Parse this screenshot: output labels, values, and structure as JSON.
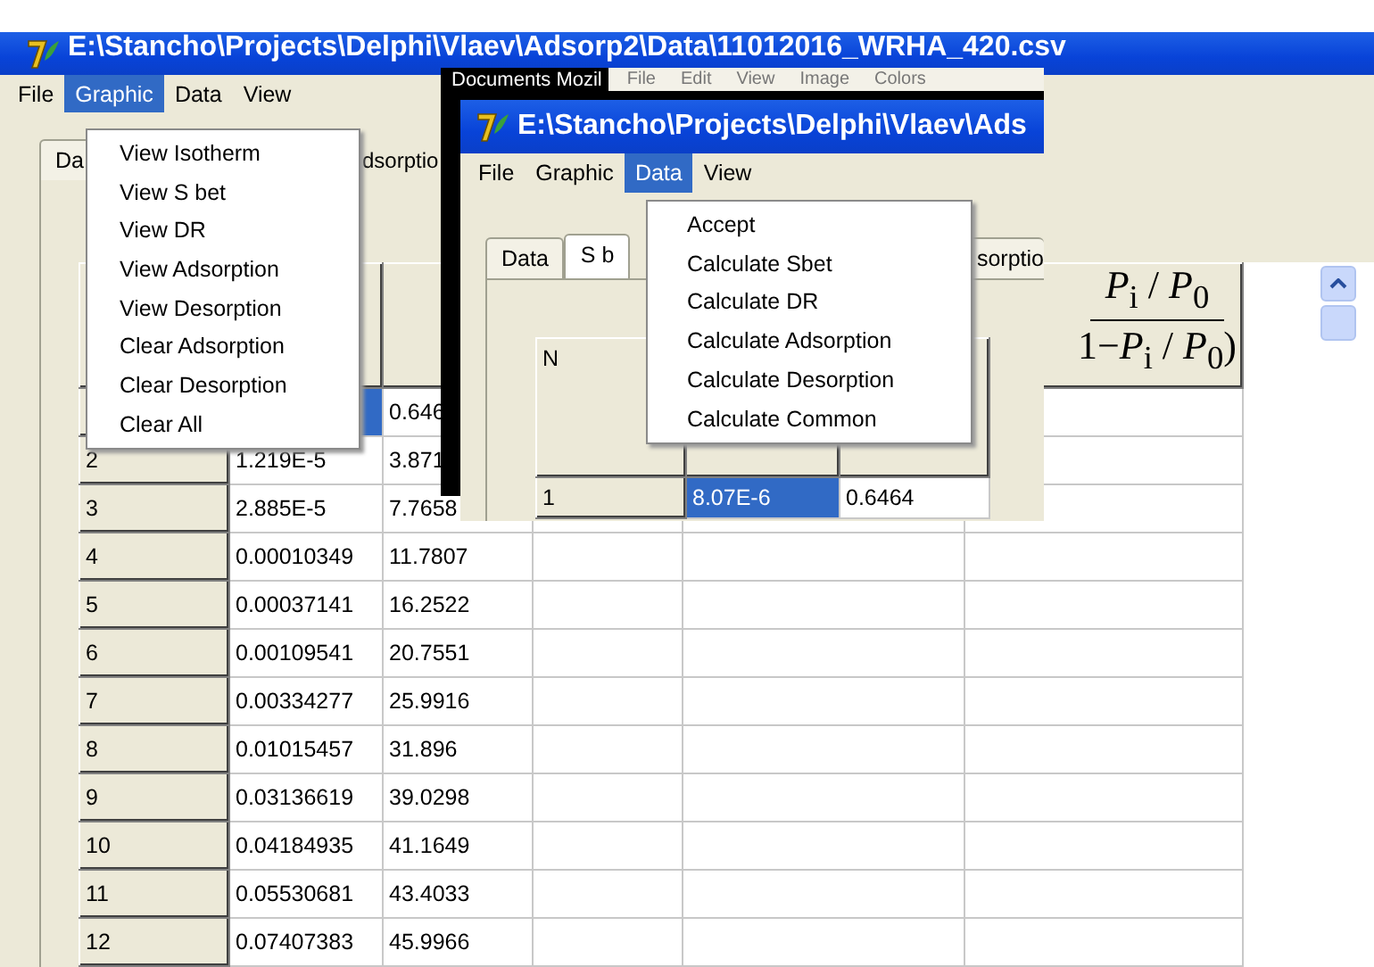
{
  "back_window": {
    "title": "E:\\Stancho\\Projects\\Delphi\\Vlaev\\Adsorp2\\Data\\11012016_WRHA_420.csv",
    "menu": [
      {
        "label": "File",
        "selected": false
      },
      {
        "label": "Graphic",
        "selected": true
      },
      {
        "label": "Data",
        "selected": false
      },
      {
        "label": "View",
        "selected": false
      }
    ],
    "tabs": [
      "Da",
      "dsorptio"
    ],
    "graphic_menu": [
      "View Isotherm",
      "View S bet",
      "View DR",
      "View Adsorption",
      "View Desorption",
      "Clear Adsorption",
      "Clear Desorption",
      "Clear All"
    ],
    "formula": {
      "numerator": "*P*$_{i}$ / *P*$_{0}$",
      "denominator": "1−*P*$_{i}$ / *P*$_{0}$)"
    },
    "rows": [
      {
        "col2": "0.646",
        "selected": true
      },
      {
        "n": "2",
        "col1": "1.219E-5",
        "col2": "3.871",
        "selected": false
      },
      {
        "n": "3",
        "col1": "2.885E-5",
        "col2": "7.7658",
        "selected": false
      },
      {
        "n": "4",
        "col1": "0.00010349",
        "col2": "11.7807",
        "selected": false
      },
      {
        "n": "5",
        "col1": "0.00037141",
        "col2": "16.2522",
        "selected": false
      },
      {
        "n": "6",
        "col1": "0.00109541",
        "col2": "20.7551",
        "selected": false
      },
      {
        "n": "7",
        "col1": "0.00334277",
        "col2": "25.9916",
        "selected": false
      },
      {
        "n": "8",
        "col1": "0.01015457",
        "col2": "31.896",
        "selected": false
      },
      {
        "n": "9",
        "col1": "0.03136619",
        "col2": "39.0298",
        "selected": false
      },
      {
        "n": "10",
        "col1": "0.04184935",
        "col2": "41.1649",
        "selected": false
      },
      {
        "n": "11",
        "col1": "0.05530681",
        "col2": "43.4033",
        "selected": false
      },
      {
        "n": "12",
        "col1": "0.07407383",
        "col2": "45.9966",
        "selected": false
      }
    ]
  },
  "behind_window": {
    "caption": "Documents  Mozil",
    "menu": [
      "File",
      "Edit",
      "View",
      "Image",
      "Colors"
    ]
  },
  "front_window": {
    "title": "E:\\Stancho\\Projects\\Delphi\\Vlaev\\Ads",
    "menu": [
      {
        "label": "File",
        "selected": false
      },
      {
        "label": "Graphic",
        "selected": false
      },
      {
        "label": "Data",
        "selected": true
      },
      {
        "label": "View",
        "selected": false
      }
    ],
    "tabs": [
      {
        "label": "Data",
        "selected": false
      },
      {
        "label": "S b",
        "selected": true
      },
      {
        "label": "sorptio",
        "selected": false
      }
    ],
    "header": "N",
    "rows": [
      {
        "n": "1",
        "col1": "8.07E-6",
        "col2": "0.6464",
        "selected": true
      }
    ],
    "data_menu": [
      "Accept",
      "Calculate Sbet",
      "Calculate DR",
      "Calculate Adsorption",
      "Calculate Desorption",
      "Calculate Common"
    ]
  }
}
